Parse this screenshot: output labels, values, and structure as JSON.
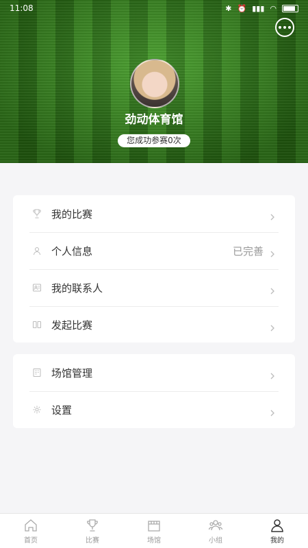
{
  "status_bar": {
    "time": "11:08"
  },
  "header": {
    "venue_name": "劲动体育馆",
    "badge": "您成功参赛0次"
  },
  "menu_group_1": [
    {
      "label": "我的比赛",
      "icon": "trophy-icon",
      "value": ""
    },
    {
      "label": "个人信息",
      "icon": "user-icon",
      "value": "已完善"
    },
    {
      "label": "我的联系人",
      "icon": "contact-card-icon",
      "value": ""
    },
    {
      "label": "发起比赛",
      "icon": "scoreboard-icon",
      "value": ""
    }
  ],
  "menu_group_2": [
    {
      "label": "场馆管理",
      "icon": "building-icon"
    },
    {
      "label": "设置",
      "icon": "gear-icon"
    }
  ],
  "tabbar": [
    {
      "label": "首页",
      "icon": "home-icon",
      "active": false
    },
    {
      "label": "比赛",
      "icon": "trophy-icon",
      "active": false
    },
    {
      "label": "场馆",
      "icon": "venue-icon",
      "active": false
    },
    {
      "label": "小组",
      "icon": "group-icon",
      "active": false
    },
    {
      "label": "我的",
      "icon": "profile-icon",
      "active": true
    }
  ],
  "colors": {
    "grass_dark": "#2c7a14",
    "grass_light": "#3f9a22",
    "background": "#f5f5f7",
    "muted_text": "#999999"
  }
}
